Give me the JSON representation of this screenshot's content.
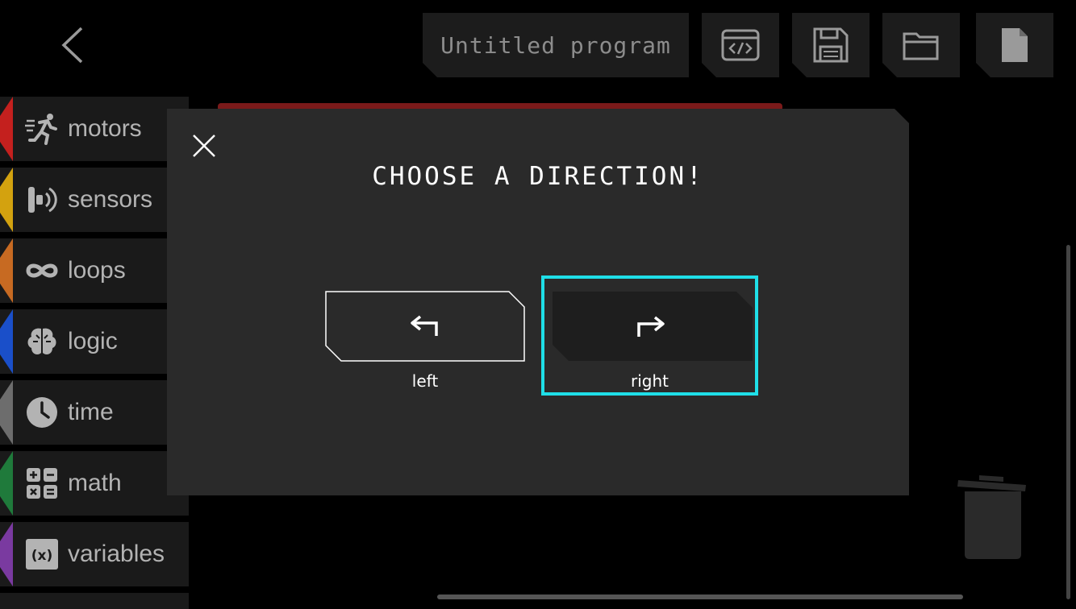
{
  "header": {
    "program_title": "Untitled program"
  },
  "sidebar": {
    "items": [
      {
        "label": "motors",
        "color": "#c4201e"
      },
      {
        "label": "sensors",
        "color": "#d3a20f"
      },
      {
        "label": "loops",
        "color": "#c76a22"
      },
      {
        "label": "logic",
        "color": "#1a4fc9"
      },
      {
        "label": "time",
        "color": "#6d6d6d"
      },
      {
        "label": "math",
        "color": "#1f7a3b"
      },
      {
        "label": "variables",
        "color": "#7a3aa0"
      }
    ]
  },
  "modal": {
    "title": "CHOOSE A DIRECTION!",
    "options": [
      {
        "label": "left",
        "selected": false
      },
      {
        "label": "right",
        "selected": true
      }
    ],
    "accent": "#1fdfe8"
  }
}
